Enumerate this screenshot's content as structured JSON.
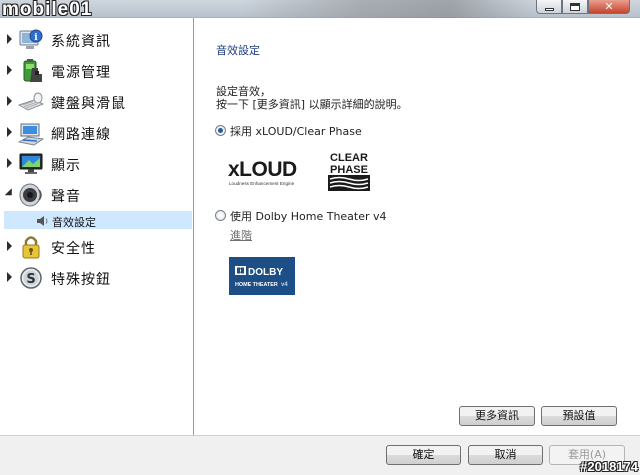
{
  "window": {
    "title": "",
    "buttons": {
      "minimize": "minimize-icon",
      "maximize": "maximize-icon",
      "close": "close-icon"
    }
  },
  "watermark": {
    "top": "mobile01",
    "bottom": "#2018174"
  },
  "sidebar": {
    "items": [
      {
        "label": "系統資訊",
        "icon": "info-computer-icon",
        "expanded": false
      },
      {
        "label": "電源管理",
        "icon": "battery-icon",
        "expanded": false
      },
      {
        "label": "鍵盤與滑鼠",
        "icon": "keyboard-mouse-icon",
        "expanded": false
      },
      {
        "label": "網路連線",
        "icon": "network-icon",
        "expanded": false
      },
      {
        "label": "顯示",
        "icon": "monitor-icon",
        "expanded": false
      },
      {
        "label": "聲音",
        "icon": "speaker-icon",
        "expanded": true
      },
      {
        "label": "安全性",
        "icon": "lock-icon",
        "expanded": false
      },
      {
        "label": "特殊按鈕",
        "icon": "special-button-icon",
        "expanded": false
      }
    ],
    "sub_item": {
      "label": "音效設定",
      "icon": "small-speaker-icon",
      "selected": true
    }
  },
  "main": {
    "section_title": "音效設定",
    "description_line1": "設定音效，",
    "description_line2": "按一下 [更多資訊] 以顯示詳細的說明。",
    "option1": {
      "label": "採用 xLOUD/Clear Phase",
      "checked": true
    },
    "xloud_logo": {
      "name": "xLOUD",
      "tagline": "Loudness Enhancement Engine"
    },
    "clearphase_logo": {
      "line1": "CLEAR",
      "line2": "PHASE"
    },
    "option2": {
      "label": "使用 Dolby Home Theater v4",
      "checked": false
    },
    "advanced_link": "進階",
    "dolby_logo": {
      "line1": "DOLBY",
      "line2": "HOME THEATER",
      "version": "v4"
    },
    "more_info_button": "更多資訊",
    "default_button": "預設值"
  },
  "footer": {
    "ok_button": "確定",
    "cancel_button": "取消",
    "apply_button": "套用(A)"
  },
  "colors": {
    "accent_title": "#1d3b80",
    "selection": "#cde8ff",
    "close_button": "#c5442c"
  }
}
